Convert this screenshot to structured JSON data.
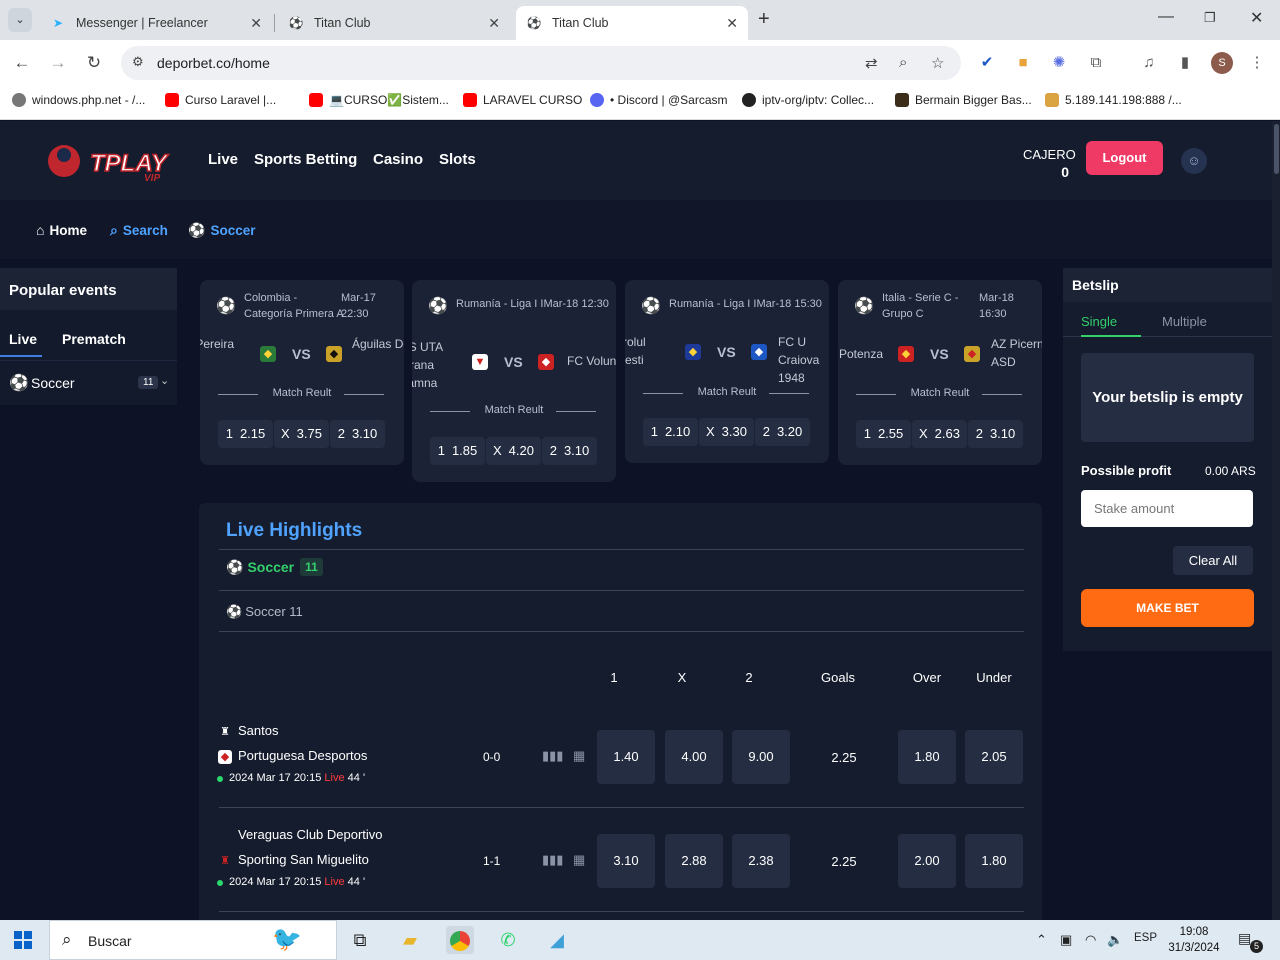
{
  "browser": {
    "tabs": [
      {
        "title": "Messenger | Freelancer"
      },
      {
        "title": "Titan Club"
      },
      {
        "title": "Titan Club"
      }
    ],
    "url": "deporbet.co/home",
    "bookmarks": [
      "windows.php.net - /...",
      "Curso Laravel |...",
      "💻CURSO✅Sistem...",
      "LARAVEL CURSO",
      "• Discord | @Sarcasm",
      "iptv-org/iptv: Collec...",
      "Bermain Bigger Bas...",
      "5.189.141.198:888 /..."
    ]
  },
  "header": {
    "logo_text": "TPLAY",
    "logo_sub": "VIP",
    "nav": [
      "Live",
      "Sports Betting",
      "Casino",
      "Slots"
    ],
    "cajero_label": "CAJERO",
    "cajero_amount": "0",
    "logout_label": "Logout"
  },
  "subnav": {
    "home": "Home",
    "search": "Search",
    "soccer": "Soccer"
  },
  "popular": {
    "title": "Popular events",
    "tabs": [
      "Live",
      "Prematch"
    ],
    "sport_name": "Soccer",
    "sport_count": "11"
  },
  "events": [
    {
      "league": "Colombia - Categoría Primera A",
      "date": "Mar-17 22:30",
      "team1": "Deportivo Pereira",
      "team2": "Águilas Doradas",
      "market": "Match Reult",
      "odds": [
        {
          "k": "1",
          "v": "2.15"
        },
        {
          "k": "X",
          "v": "3.75"
        },
        {
          "k": "2",
          "v": "3.10"
        }
      ]
    },
    {
      "league": "Rumanía - Liga I",
      "date": "Mar-18 12:30",
      "team1": "ACS UTA Batrana Doamna",
      "team2": "FC Voluntari",
      "market": "Match Reult",
      "odds": [
        {
          "k": "1",
          "v": "1.85"
        },
        {
          "k": "X",
          "v": "4.20"
        },
        {
          "k": "2",
          "v": "3.10"
        }
      ]
    },
    {
      "league": "Rumanía - Liga I",
      "date": "Mar-18 15:30",
      "team1": "Petrolul Ploiesti",
      "team2": "FC U Craiova 1948",
      "market": "Match Reult",
      "odds": [
        {
          "k": "1",
          "v": "2.10"
        },
        {
          "k": "X",
          "v": "3.30"
        },
        {
          "k": "2",
          "v": "3.20"
        }
      ]
    },
    {
      "league": "Italia - Serie C - Grupo C",
      "date": "Mar-18 16:30",
      "team1": "Potenza",
      "team2": "AZ Picerno ASD",
      "market": "Match Reult",
      "odds": [
        {
          "k": "1",
          "v": "2.55"
        },
        {
          "k": "X",
          "v": "2.63"
        },
        {
          "k": "2",
          "v": "3.10"
        }
      ]
    }
  ],
  "highlights": {
    "title": "Live Highlights",
    "sport": "Soccer",
    "sport_count": "11",
    "sub": "Soccer 11",
    "columns": [
      "1",
      "X",
      "2",
      "Goals",
      "Over",
      "Under"
    ],
    "matches": [
      {
        "team1": "Santos",
        "team2": "Portuguesa Desportos",
        "date": "2024 Mar 17 20:15",
        "live": "Live",
        "minute": "44 '",
        "score": "0-0",
        "odds": [
          "1.40",
          "4.00",
          "9.00"
        ],
        "goals": "2.25",
        "over": "1.80",
        "under": "2.05"
      },
      {
        "team1": "Veraguas Club Deportivo",
        "team2": "Sporting San Miguelito",
        "date": "2024 Mar 17 20:15",
        "live": "Live",
        "minute": "44 '",
        "score": "1-1",
        "odds": [
          "3.10",
          "2.88",
          "2.38"
        ],
        "goals": "2.25",
        "over": "2.00",
        "under": "1.80"
      }
    ]
  },
  "betslip": {
    "title": "Betslip",
    "single": "Single",
    "multiple": "Multiple",
    "empty": "Your betslip is empty",
    "profit_label": "Possible profit",
    "profit_value": "0.00 ARS",
    "stake_placeholder": "Stake amount",
    "clear": "Clear All",
    "make_bet": "MAKE BET"
  },
  "taskbar": {
    "search": "Buscar",
    "lang": "ESP",
    "time": "19:08",
    "date": "31/3/2024",
    "notif": "5"
  }
}
